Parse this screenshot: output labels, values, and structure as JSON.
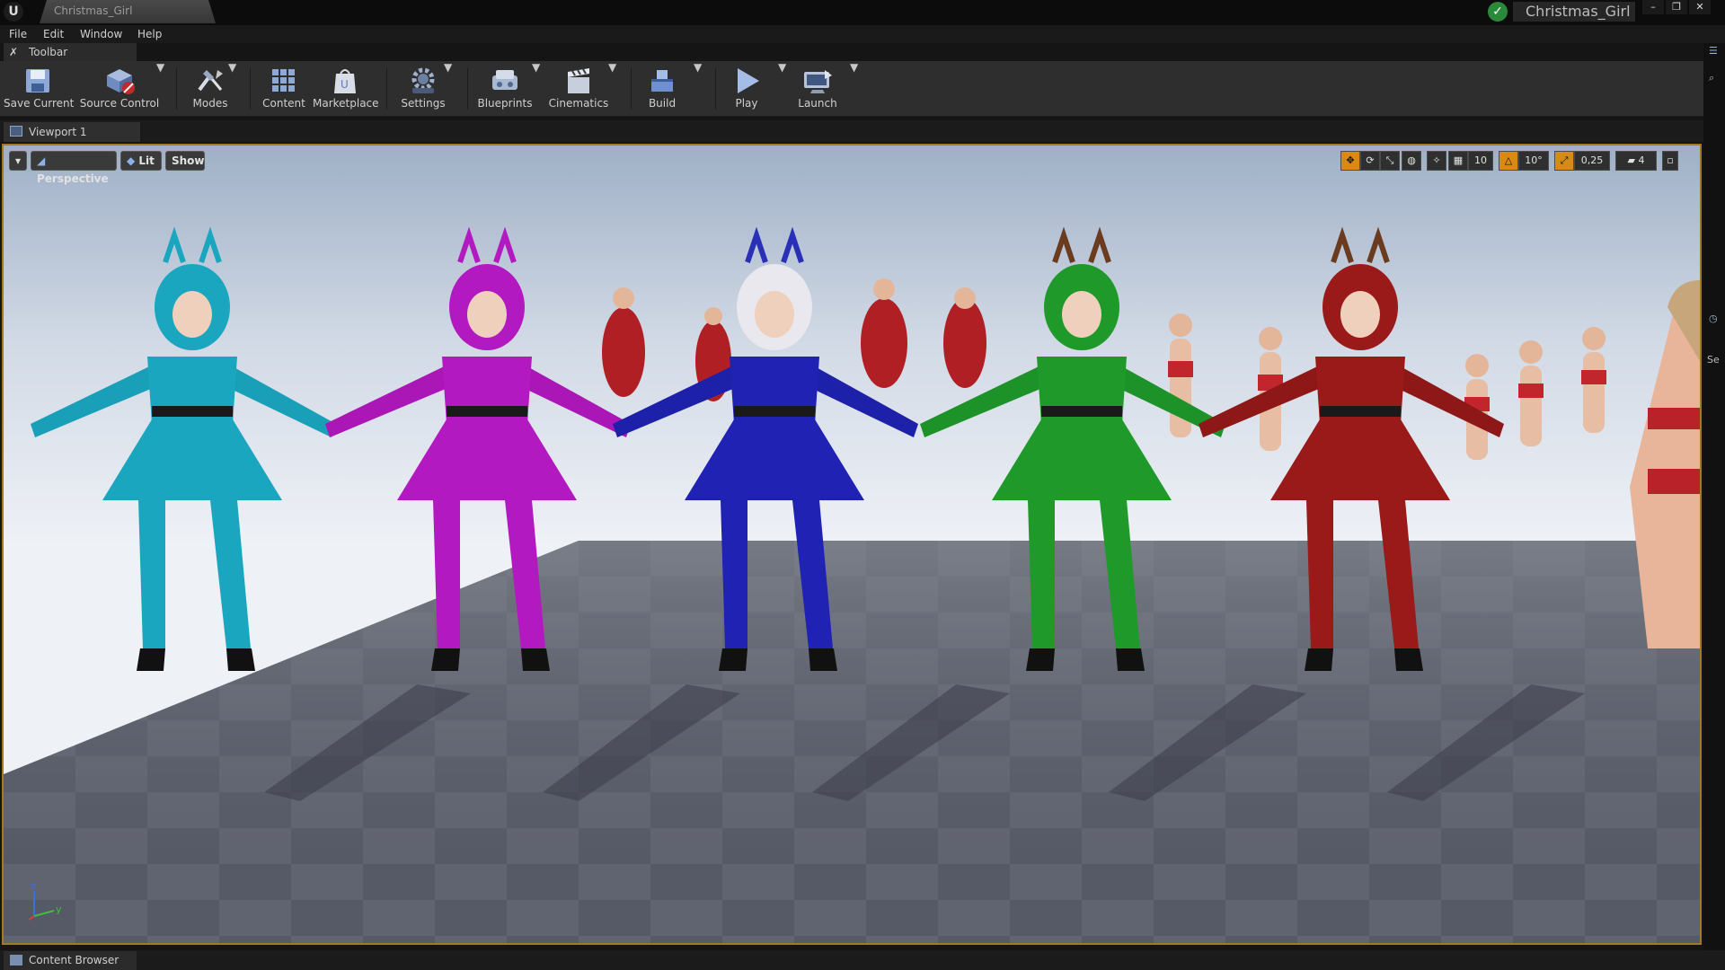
{
  "window": {
    "document_tab": "Christmas_Girl",
    "project_name": "Christmas_Girl",
    "controls": [
      "minimize",
      "restore",
      "close"
    ]
  },
  "menu": [
    "File",
    "Edit",
    "Window",
    "Help"
  ],
  "toolbar_tab": {
    "label": "Toolbar"
  },
  "toolbar": {
    "save_current": "Save Current",
    "source_control": "Source Control",
    "modes": "Modes",
    "content": "Content",
    "marketplace": "Marketplace",
    "settings": "Settings",
    "blueprints": "Blueprints",
    "cinematics": "Cinematics",
    "build": "Build",
    "play": "Play",
    "launch": "Launch"
  },
  "viewport_tab": {
    "label": "Viewport 1"
  },
  "viewport": {
    "view_mode": "Perspective",
    "lighting": "Lit",
    "show": "Show",
    "grid_snap": "10",
    "rotation_snap": "10°",
    "scale_snap": "0,25",
    "camera_speed": "4",
    "axis_labels": {
      "z": "z",
      "y": "y"
    }
  },
  "scene": {
    "sky_color": "#e6ebf2",
    "floor_color": "#5b5f6d",
    "characters": [
      {
        "outfit": "teal",
        "color": "#1aa6bf"
      },
      {
        "outfit": "magenta",
        "color": "#b319c0"
      },
      {
        "outfit": "blue",
        "color": "#1f22b2"
      },
      {
        "outfit": "green",
        "color": "#1f9a2a"
      },
      {
        "outfit": "red",
        "color": "#9a1a1a"
      }
    ]
  },
  "right_panel": {
    "label": "Se"
  },
  "content_browser_tab": {
    "label": "Content Browser"
  },
  "colors": {
    "accent": "#d78a14",
    "selection_border": "#a07b22"
  }
}
